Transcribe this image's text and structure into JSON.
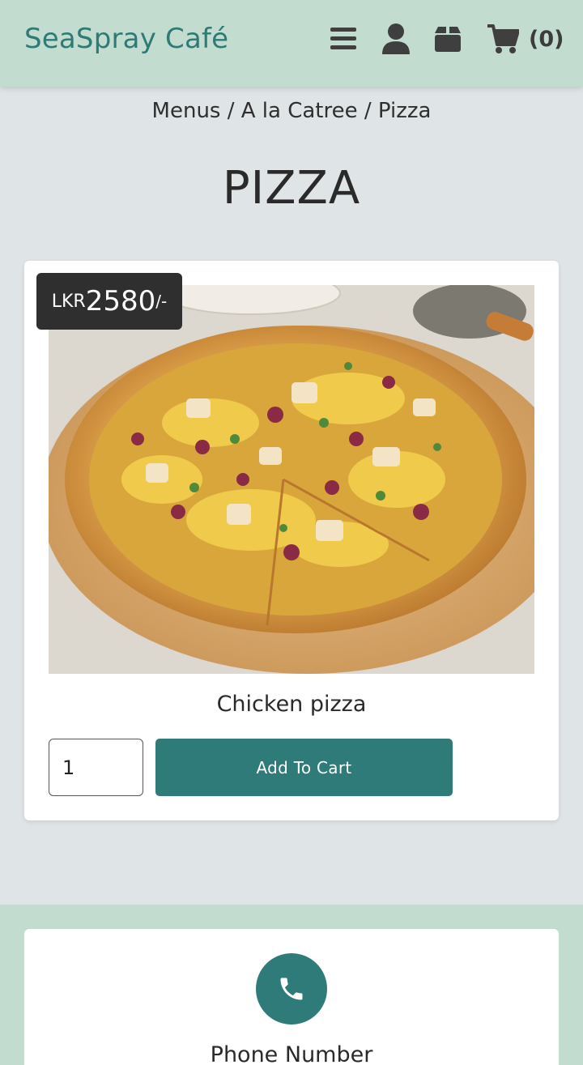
{
  "header": {
    "brand": "SeaSpray Café",
    "cart_count": "(0)",
    "icons": [
      "menu-icon",
      "user-icon",
      "box-icon",
      "cart-icon"
    ]
  },
  "breadcrumb": "Menus / A la Catree / Pizza",
  "page": {
    "title": "PIZZA"
  },
  "product": {
    "currency": "LKR",
    "price": "2580",
    "price_suffix": "/-",
    "name": "Chicken pizza",
    "quantity": "1",
    "add_label": "Add To Cart",
    "image": "pizza-photo"
  },
  "contact": {
    "icon": "phone-icon",
    "label": "Phone Number"
  },
  "colors": {
    "accent": "#2e7b79",
    "header_bg": "#c2ddd0",
    "page_bg": "#dfe5e6",
    "badge_bg": "#2f2f2f"
  }
}
